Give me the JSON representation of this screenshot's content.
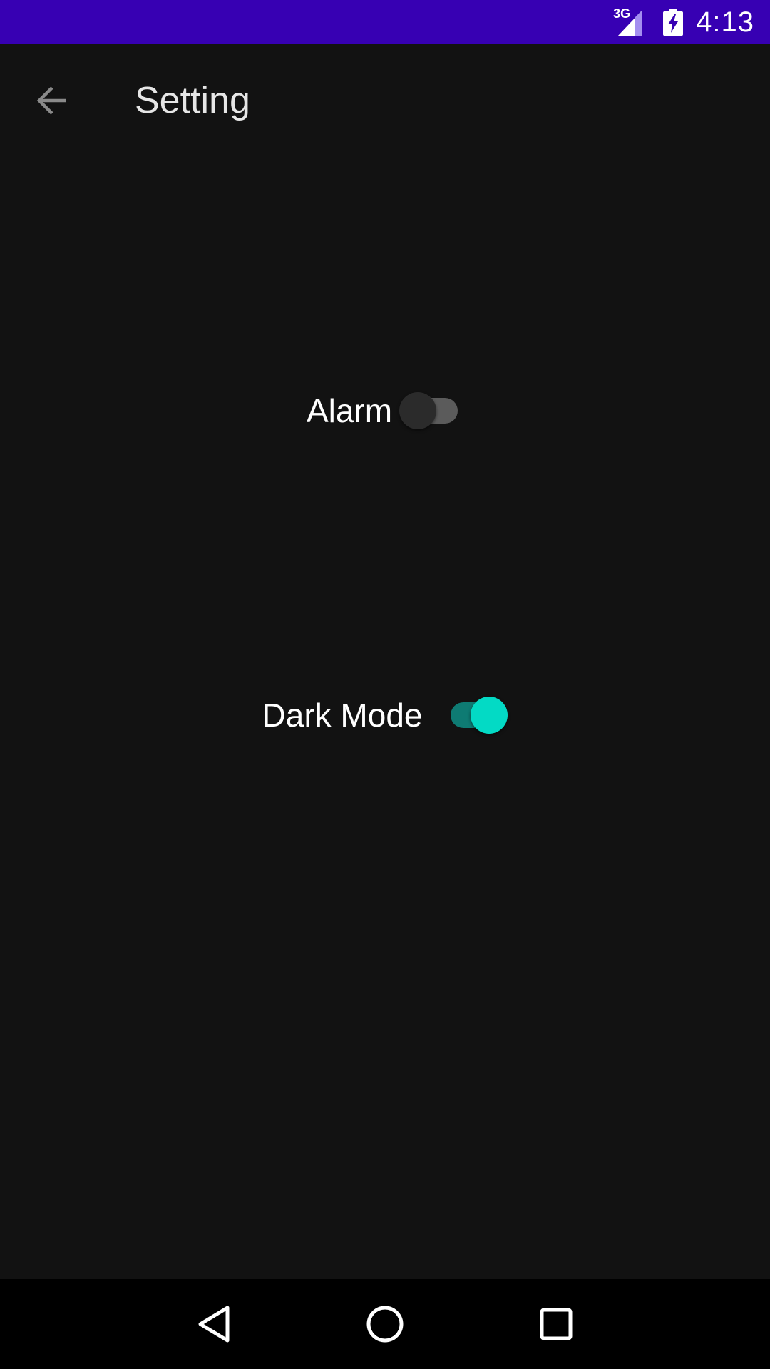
{
  "status_bar": {
    "network_type": "3G",
    "time": "4:13",
    "icons": [
      "signal-icon",
      "battery-charging-icon"
    ],
    "background_color": "#3700b3"
  },
  "app_bar": {
    "title": "Setting",
    "back_icon": "arrow-back-icon"
  },
  "settings": {
    "alarm": {
      "label": "Alarm",
      "enabled": false
    },
    "dark_mode": {
      "label": "Dark Mode",
      "enabled": true
    }
  },
  "nav_bar": {
    "icons": [
      "back-triangle-icon",
      "home-circle-icon",
      "recents-square-icon"
    ]
  },
  "colors": {
    "background": "#121212",
    "accent": "#03dac5",
    "accent_track": "#0e7b73"
  }
}
